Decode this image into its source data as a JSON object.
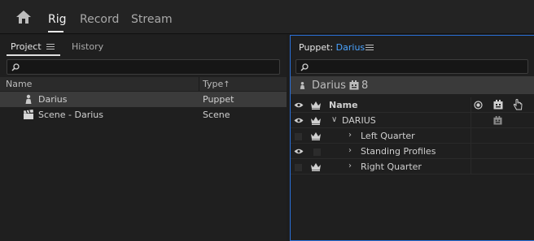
{
  "app": {
    "tabs": [
      {
        "label": "Rig",
        "active": true
      },
      {
        "label": "Record",
        "active": false
      },
      {
        "label": "Stream",
        "active": false
      }
    ]
  },
  "left_panel": {
    "tabs": [
      {
        "label": "Project",
        "active": true
      },
      {
        "label": "History",
        "active": false
      }
    ],
    "search": {
      "placeholder": ""
    },
    "columns": {
      "name": "Name",
      "type": "Type"
    },
    "sort_indicator": "↑",
    "rows": [
      {
        "name": "Darius",
        "type": "Puppet",
        "icon": "puppet-icon",
        "selected": true
      },
      {
        "name": "Scene - Darius",
        "type": "Scene",
        "icon": "clapperboard-icon",
        "selected": false
      }
    ]
  },
  "right_panel": {
    "title_prefix": "Puppet:",
    "puppet_name": "Darius",
    "search": {
      "placeholder": ""
    },
    "puppet_bar": {
      "name": "Darius",
      "count": "8"
    },
    "columns": {
      "name": "Name"
    },
    "layers": [
      {
        "label": "DARIUS",
        "expanded": true,
        "indent": 0,
        "visible": true,
        "has_handle_icon": true
      },
      {
        "label": "Left Quarter",
        "expanded": false,
        "indent": 1,
        "visible": false,
        "has_handle_icon": false
      },
      {
        "label": "Standing Profiles",
        "expanded": false,
        "indent": 1,
        "visible": true,
        "has_handle_icon": false
      },
      {
        "label": "Right Quarter",
        "expanded": false,
        "indent": 1,
        "visible": false,
        "has_handle_icon": false
      }
    ]
  },
  "colors": {
    "accent": "#2a6fd6",
    "puppet_name": "#4aa3ff",
    "background": "#1d1d1d",
    "selected_row": "#3b3b3b"
  }
}
